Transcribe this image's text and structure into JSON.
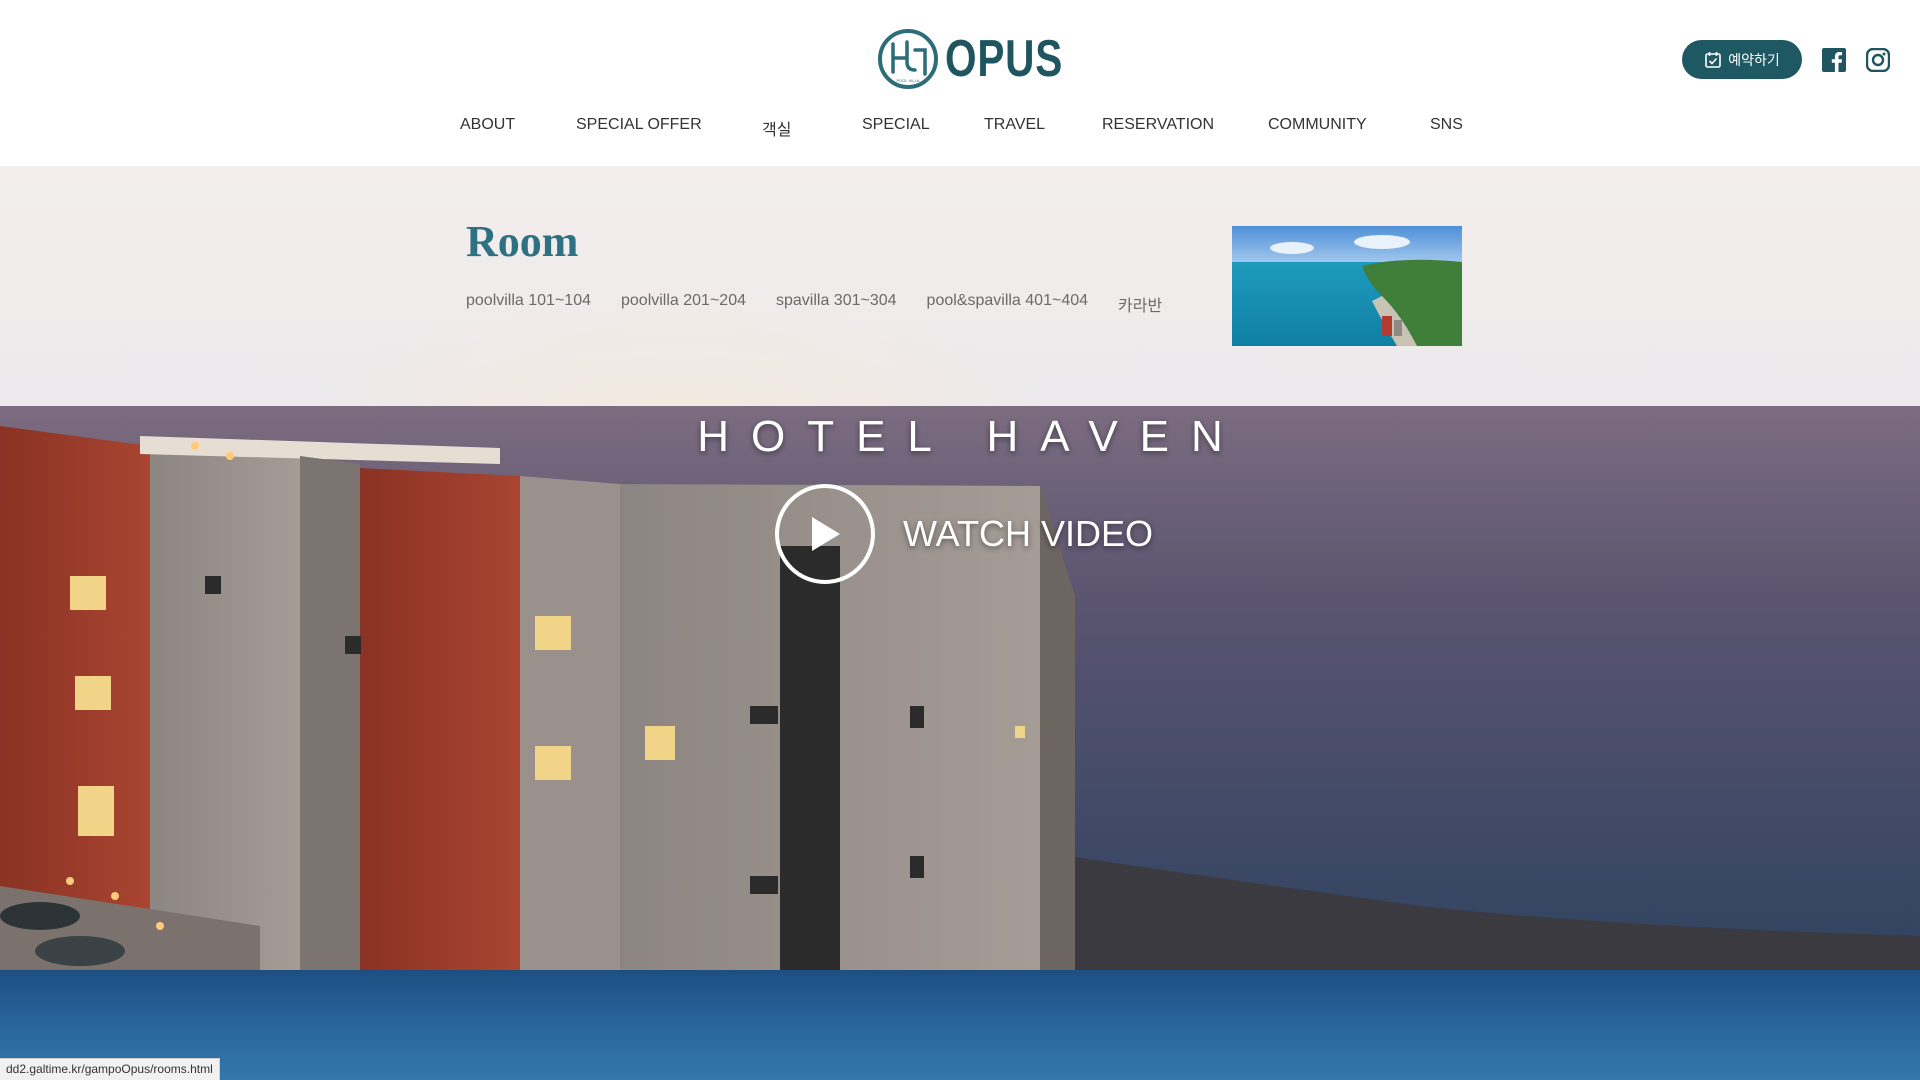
{
  "brand": {
    "name": "OPUS",
    "sub": "POOL VILLA"
  },
  "header": {
    "reserve_label": "예약하기",
    "nav": [
      "ABOUT",
      "SPECIAL OFFER",
      "객실",
      "SPECIAL",
      "TRAVEL",
      "RESERVATION",
      "COMMUNITY",
      "SNS"
    ]
  },
  "subhead": {
    "title": "Room",
    "tabs": [
      "poolvilla 101~104",
      "poolvilla 201~204",
      "spavilla 301~304",
      "pool&spavilla 401~404",
      "카라반"
    ]
  },
  "hero": {
    "title": "HOTEL HAVEN",
    "watch_label": "WATCH VIDEO"
  },
  "status": {
    "url": "dd2.galtime.kr/gampoOpus/rooms.html"
  },
  "colors": {
    "brand": "#1f5560",
    "button": "#1e5862",
    "title": "#2e7183"
  }
}
